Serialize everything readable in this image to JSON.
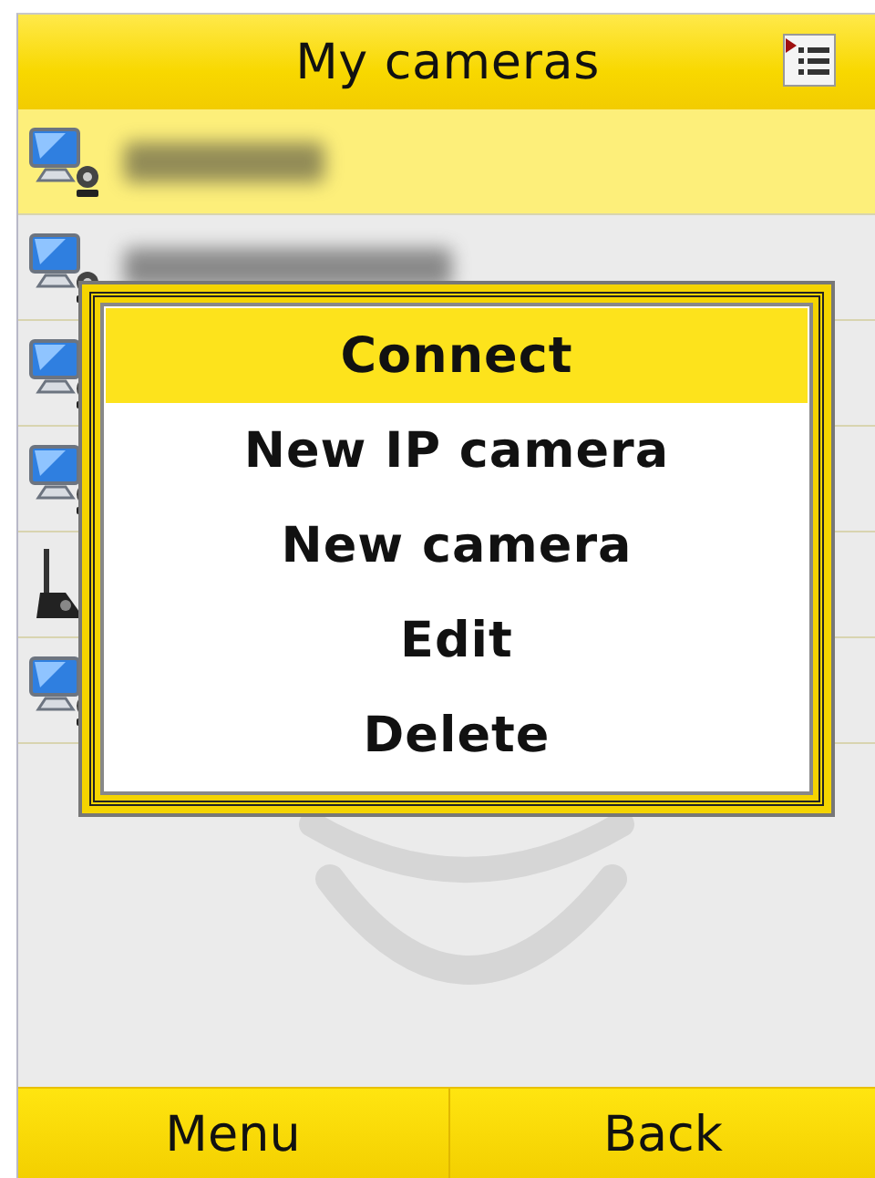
{
  "header": {
    "title": "My cameras"
  },
  "cameras": [
    {
      "kind": "webcam",
      "selected": true,
      "blurred": true
    },
    {
      "kind": "webcam",
      "selected": false,
      "blurred": true
    },
    {
      "kind": "webcam",
      "selected": false
    },
    {
      "kind": "webcam",
      "selected": false
    },
    {
      "kind": "antenna",
      "selected": false
    },
    {
      "kind": "webcam",
      "selected": false
    }
  ],
  "popup_menu": [
    {
      "label": "Connect",
      "selected": true
    },
    {
      "label": "New IP camera",
      "selected": false
    },
    {
      "label": "New camera",
      "selected": false
    },
    {
      "label": "Edit",
      "selected": false
    },
    {
      "label": "Delete",
      "selected": false
    }
  ],
  "softkeys": [
    "Menu",
    "Back"
  ]
}
